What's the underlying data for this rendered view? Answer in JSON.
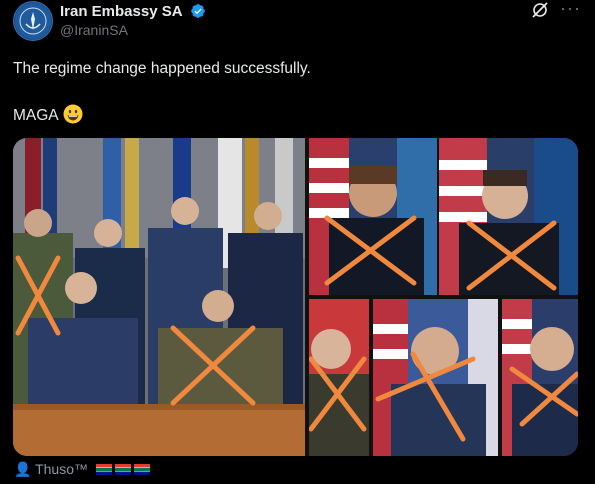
{
  "post": {
    "author_name": "Iran Embassy SA",
    "author_handle": "@IraninSA",
    "text": "The regime change happened successfully.",
    "text2": "MAGA",
    "emoji": "grinning-face"
  },
  "icons": {
    "verified": "verified-badge-icon",
    "grok": "grok-icon",
    "more": "more-icon",
    "avatar": "embassy-logo"
  },
  "footer": {
    "label": "Thuso™",
    "flags_emoji": "🇿🇦🇿🇦🇿🇦"
  },
  "colors": {
    "background": "#000000",
    "text": "#e7e9ea",
    "muted": "#71767b",
    "verified": "#1d9bf0",
    "cross": "#f0883e"
  }
}
